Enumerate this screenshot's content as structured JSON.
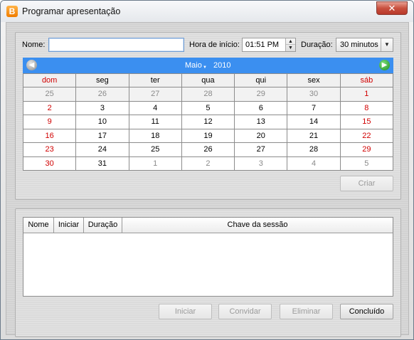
{
  "window": {
    "title": "Programar apresentação",
    "app_icon": "B",
    "close_glyph": "✕"
  },
  "form": {
    "name_label": "Nome:",
    "name_value": "",
    "start_label": "Hora de início:",
    "start_value": "01:51 PM",
    "duration_label": "Duração:",
    "duration_value": "30 minutos"
  },
  "calendar": {
    "month": "Maio",
    "year": "2010",
    "weekdays": [
      "dom",
      "seg",
      "ter",
      "qua",
      "qui",
      "sex",
      "sáb"
    ],
    "weeks": [
      [
        "25",
        "26",
        "27",
        "28",
        "29",
        "30",
        "1"
      ],
      [
        "2",
        "3",
        "4",
        "5",
        "6",
        "7",
        "8"
      ],
      [
        "9",
        "10",
        "11",
        "12",
        "13",
        "14",
        "15"
      ],
      [
        "16",
        "17",
        "18",
        "19",
        "20",
        "21",
        "22"
      ],
      [
        "23",
        "24",
        "25",
        "26",
        "27",
        "28",
        "29"
      ],
      [
        "30",
        "31",
        "1",
        "2",
        "3",
        "4",
        "5"
      ]
    ],
    "weekend_color": "#d10000",
    "header_color": "#3b8ff0"
  },
  "buttons": {
    "create": "Criar",
    "start": "Iniciar",
    "invite": "Convidar",
    "delete": "Eliminar",
    "done": "Concluído"
  },
  "sessions": {
    "columns": [
      "Nome",
      "Iniciar",
      "Duração",
      "Chave da sessão"
    ],
    "rows": []
  },
  "icons": {
    "prev": "arrow-left-icon",
    "next": "arrow-right-icon"
  }
}
